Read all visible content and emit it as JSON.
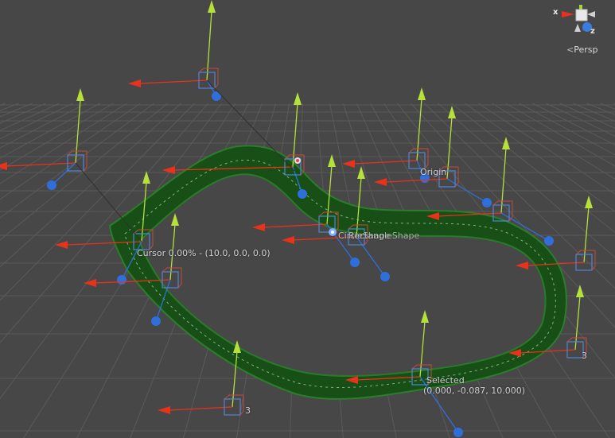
{
  "scene": {
    "cursor_label": "Cursor 0.00% - (10.0, 0.0, 0.0)",
    "origin_label": "Origin",
    "selected_label": "Selected",
    "selected_coords": "(0.000, -0.087, 10.000)",
    "overlap_label_a": "CircleShape",
    "overlap_label_b": "RectangleShape",
    "index_label_a": "3",
    "index_label_b": "3"
  },
  "orientation_gizmo": {
    "x_label": "x",
    "z_label": "z",
    "projection_label": "Persp",
    "projection_symbol": "<",
    "colors": {
      "x": "#e8321c",
      "y": "#a8d535",
      "z": "#3b7dde"
    }
  },
  "colors": {
    "background": "#474747",
    "grid": "#5a5a5a",
    "track_fill": "#1b5e1b",
    "track_edge": "#2f8a2f",
    "axis_x": "#e8321c",
    "axis_y": "#b6e03a",
    "axis_z": "#2f6fdc"
  }
}
